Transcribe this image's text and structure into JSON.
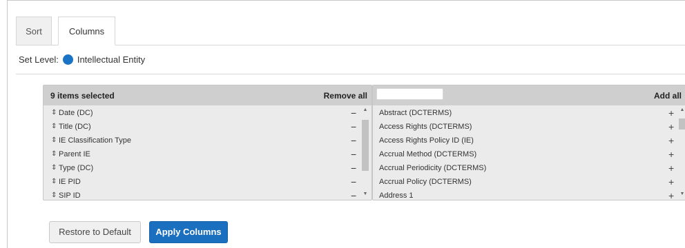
{
  "tabs": [
    {
      "label": "Sort",
      "active": false
    },
    {
      "label": "Columns",
      "active": true
    }
  ],
  "set_level": {
    "label": "Set Level:",
    "value": "Intellectual Entity",
    "dot_color": "#1a73c4"
  },
  "selected_panel": {
    "header": "9 items selected",
    "action": "Remove all",
    "items": [
      "Date (DC)",
      "Title (DC)",
      "IE Classification Type",
      "Parent IE",
      "Type (DC)",
      "IE PID",
      "SIP ID"
    ]
  },
  "available_panel": {
    "filter_placeholder": "",
    "action": "Add all",
    "items": [
      "Abstract (DCTERMS)",
      "Access Rights (DCTERMS)",
      "Access Rights Policy ID (IE)",
      "Accrual Method (DCTERMS)",
      "Accrual Periodicity (DCTERMS)",
      "Accrual Policy (DCTERMS)",
      "Address 1"
    ]
  },
  "buttons": {
    "restore": "Restore to Default",
    "apply": "Apply Columns"
  },
  "colors": {
    "accent": "#1a6fbf",
    "header_bg": "#cfcfcf",
    "panel_bg": "#ebebeb"
  }
}
